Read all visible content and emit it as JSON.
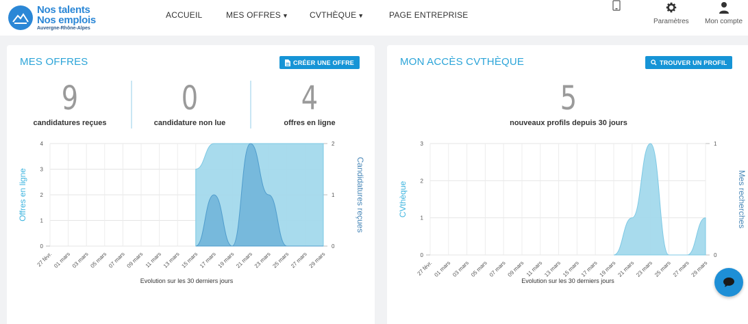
{
  "logo": {
    "line1": "Nos talents",
    "line2": "Nos emplois",
    "line3": "Auvergne-Rhône-Alpes"
  },
  "nav": {
    "accueil": "ACCUEIL",
    "mes_offres": "MES OFFRES",
    "cvtheque": "CVTHÈQUE",
    "page_entreprise": "PAGE ENTREPRISE"
  },
  "header_icons": {
    "parametres": "Paramètres",
    "mon_compte": "Mon compte"
  },
  "colors": {
    "accent": "#2ba4d8",
    "button": "#1694d6",
    "area_light": "#a3d9ec",
    "area_dark": "#6fb3d8"
  },
  "mes_offres": {
    "title": "MES OFFRES",
    "button": "CRÉER UNE OFFRE",
    "stats": [
      {
        "value": "9",
        "label": "candidatures reçues"
      },
      {
        "value": "0",
        "label": "candidature non lue"
      },
      {
        "value": "4",
        "label": "offres en ligne"
      }
    ]
  },
  "cvtheque": {
    "title": "MON ACCÈS CVTHÈQUE",
    "button": "TROUVER UN PROFIL",
    "stat": {
      "value": "5",
      "label": "nouveaux profils depuis 30 jours"
    }
  },
  "chart_data": [
    {
      "type": "area",
      "xlabel": "Evolution sur les 30 derniers jours",
      "ylabel_left": "Offres en ligne",
      "ylabel_right": "Candidatures reçues",
      "ylim_left": [
        0,
        4
      ],
      "ylim_right": [
        0,
        2
      ],
      "yticks_left": [
        "0",
        "1",
        "2",
        "3",
        "4"
      ],
      "yticks_right": [
        "0",
        "1",
        "2"
      ],
      "categories": [
        "27 févr.",
        "01 mars",
        "03 mars",
        "05 mars",
        "07 mars",
        "09 mars",
        "11 mars",
        "13 mars",
        "15 mars",
        "17 mars",
        "19 mars",
        "21 mars",
        "23 mars",
        "25 mars",
        "27 mars",
        "29 mars"
      ],
      "series": [
        {
          "name": "Offres en ligne",
          "axis": "left",
          "values": [
            0,
            0,
            0,
            0,
            0,
            0,
            0,
            0,
            3,
            4,
            4,
            4,
            4,
            4,
            4,
            4
          ]
        },
        {
          "name": "Candidatures reçues",
          "axis": "right",
          "values": [
            0,
            0,
            0,
            0,
            0,
            0,
            0,
            0,
            0,
            1,
            0,
            2,
            1,
            0,
            0,
            0
          ]
        }
      ]
    },
    {
      "type": "area",
      "xlabel": "Evolution sur les 30 derniers jours",
      "ylabel_left": "CVthèque",
      "ylabel_right": "Mes recherches",
      "ylim_left": [
        0,
        3
      ],
      "ylim_right": [
        0,
        1
      ],
      "yticks_left": [
        "0",
        "1",
        "2",
        "3"
      ],
      "yticks_right": [
        "0",
        "1"
      ],
      "categories": [
        "27 févr.",
        "01 mars",
        "03 mars",
        "05 mars",
        "07 mars",
        "09 mars",
        "11 mars",
        "13 mars",
        "15 mars",
        "17 mars",
        "19 mars",
        "21 mars",
        "23 mars",
        "25 mars",
        "27 mars",
        "29 mars"
      ],
      "series": [
        {
          "name": "CVthèque",
          "axis": "left",
          "values": [
            0,
            0,
            0,
            0,
            0,
            0,
            0,
            0,
            0,
            0,
            0,
            1,
            3,
            0,
            0,
            1
          ]
        }
      ]
    }
  ]
}
